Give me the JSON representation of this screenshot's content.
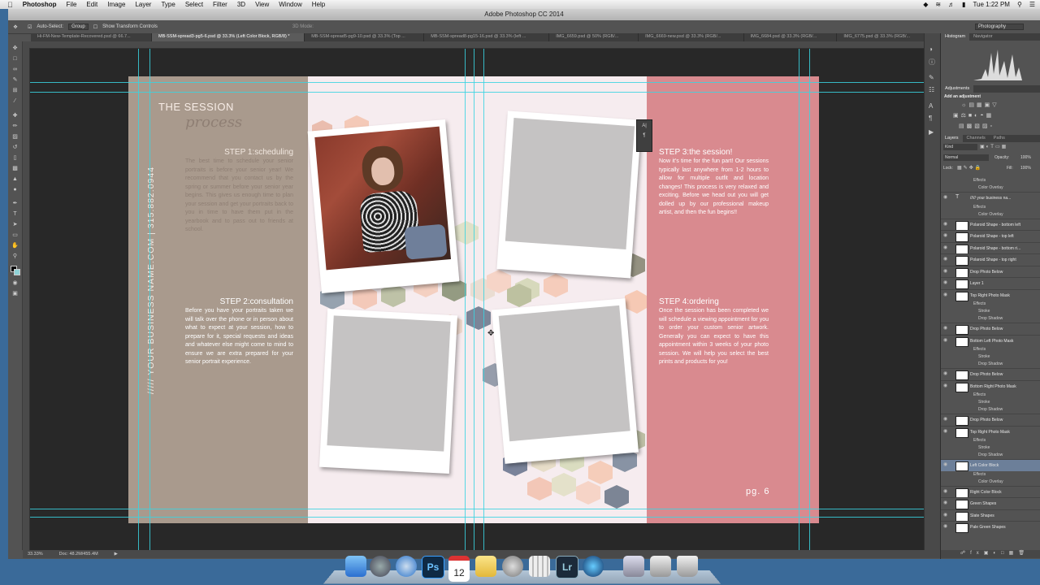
{
  "menubar": {
    "app_name": "Photoshop",
    "items": [
      "File",
      "Edit",
      "Image",
      "Layer",
      "Type",
      "Select",
      "Filter",
      "3D",
      "View",
      "Window",
      "Help"
    ],
    "clock": "Tue 1:22 PM"
  },
  "window": {
    "title": "Adobe Photoshop CC 2014"
  },
  "options_bar": {
    "auto_select_label": "Auto-Select:",
    "auto_select_value": "Group",
    "show_transform_label": "Show Transform Controls",
    "mode_3d": "3D Mode:",
    "workspace": "Photography"
  },
  "doc_tabs": [
    {
      "label": "Hi-FM-New-Template-Recovered.psd @ 66.7..."
    },
    {
      "label": "MB-SSM-spread3-pg5-6.psd @ 33.3% (Left Color Block, RGB/8) *"
    },
    {
      "label": "MB-SSM-spread5-pg9-10.psd @ 33.3% (Top ..."
    },
    {
      "label": "MB-SSM-spread8-pg15-16.psd @ 33.3% (left ..."
    },
    {
      "label": "IMG_6659.psd @ 50% (RGB/..."
    },
    {
      "label": "IMG_6669-new.psd @ 33.3% (RGB/..."
    },
    {
      "label": "IMG_6684.psd @ 33.3% (RGB/..."
    },
    {
      "label": "IMG_6775.psd @ 33.3% (RGB/..."
    }
  ],
  "status": {
    "zoom": "33.33%",
    "doc_size": "Doc: 48.2M/455.4M"
  },
  "document": {
    "heading": "THE SESSION",
    "heading_script": "process",
    "vertical_text": "///// YOUR BUSINESS NAME.COM | 315.882.0944",
    "step1": {
      "title_bold": "STEP 1:",
      "title_rest": "scheduling",
      "body": "The best time to schedule your senior portraits is before your senior year! We recommend that you contact us by the spring or summer before your senior year begins. This gives us enough time to plan your session and get your portraits back to you in time to have them put in the yearbook and to pass out to friends at school."
    },
    "step2": {
      "title_bold": "STEP 2:",
      "title_rest": "consultation",
      "body": "Before you have your portraits taken we will talk over the phone or in person about what to expect at your session, how to prepare for it, special requests and ideas and whatever else might come to mind to ensure we are extra prepared for your senior portrait experience."
    },
    "step3": {
      "title_bold": "STEP 3:",
      "title_rest": "the session!",
      "body": "Now it's time for the fun part! Our sessions typically last anywhere from 1-2 hours to allow for multiple outfit and location changes! This process is very relaxed and exciting. Before we head out you will get dolled up by our professional makeup artist, and then the fun begins!!"
    },
    "step4": {
      "title_bold": "STEP 4:",
      "title_rest": "ordering",
      "body": "Once the session has been completed we will schedule a viewing appointment for you to order your custom senior artwork. Generally you can expect to have this appointment within 3 weeks of your photo session. We will help you select the best prints and products for you!"
    },
    "page_number": "pg. 6"
  },
  "panels": {
    "top_tabs": [
      "Histogram",
      "Navigator"
    ],
    "adjustments_title": "Adjustments",
    "adjustments_hint": "Add an adjustment",
    "layer_tabs": [
      "Layers",
      "Channels",
      "Paths"
    ],
    "filter_kind": "Kind",
    "blend_mode": "Normal",
    "opacity_label": "Opacity:",
    "opacity_value": "100%",
    "lock_label": "Lock:",
    "fill_label": "Fill:",
    "fill_value": "100%",
    "layers": [
      {
        "name": "Effects",
        "type": "fx"
      },
      {
        "name": "Color Overlay",
        "type": "fxsub"
      },
      {
        "name": "///// your business na...",
        "type": "text"
      },
      {
        "name": "Effects",
        "type": "fx"
      },
      {
        "name": "Color Overlay",
        "type": "fxsub"
      },
      {
        "name": "Polaroid Shape - bottom left",
        "type": "layer"
      },
      {
        "name": "Polaroid Shape - top left",
        "type": "layer"
      },
      {
        "name": "Polaroid Shape - bottom ri...",
        "type": "layer"
      },
      {
        "name": "Polaroid Shape - top right",
        "type": "layer"
      },
      {
        "name": "Drop Photo Below",
        "type": "layer"
      },
      {
        "name": "Layer 1",
        "type": "layer"
      },
      {
        "name": "Top Right Photo Mask",
        "type": "layer"
      },
      {
        "name": "Effects",
        "type": "fx"
      },
      {
        "name": "Stroke",
        "type": "fxsub"
      },
      {
        "name": "Drop Shadow",
        "type": "fxsub"
      },
      {
        "name": "Drop Photo Below",
        "type": "layer"
      },
      {
        "name": "Bottom Left Photo Mask",
        "type": "layer"
      },
      {
        "name": "Effects",
        "type": "fx"
      },
      {
        "name": "Stroke",
        "type": "fxsub"
      },
      {
        "name": "Drop Shadow",
        "type": "fxsub"
      },
      {
        "name": "Drop Photo Below",
        "type": "layer"
      },
      {
        "name": "Bottom Right Photo Mask",
        "type": "layer"
      },
      {
        "name": "Effects",
        "type": "fx"
      },
      {
        "name": "Stroke",
        "type": "fxsub"
      },
      {
        "name": "Drop Shadow",
        "type": "fxsub"
      },
      {
        "name": "Drop Photo Below",
        "type": "layer"
      },
      {
        "name": "Top Right Photo Mask",
        "type": "layer"
      },
      {
        "name": "Effects",
        "type": "fx"
      },
      {
        "name": "Stroke",
        "type": "fxsub"
      },
      {
        "name": "Drop Shadow",
        "type": "fxsub"
      },
      {
        "name": "Left Color Block",
        "type": "layer",
        "selected": true
      },
      {
        "name": "Effects",
        "type": "fx"
      },
      {
        "name": "Color Overlay",
        "type": "fxsub"
      },
      {
        "name": "Right Color Block",
        "type": "layer"
      },
      {
        "name": "Green Shapes",
        "type": "layer"
      },
      {
        "name": "Slate Shapes",
        "type": "layer"
      },
      {
        "name": "Pale Green Shapes",
        "type": "layer"
      }
    ]
  },
  "colors": {
    "left_block": "#a99a8d",
    "right_block": "#d98a8f",
    "guide": "#3ad4e0",
    "selected_layer": "#6c7f99"
  }
}
